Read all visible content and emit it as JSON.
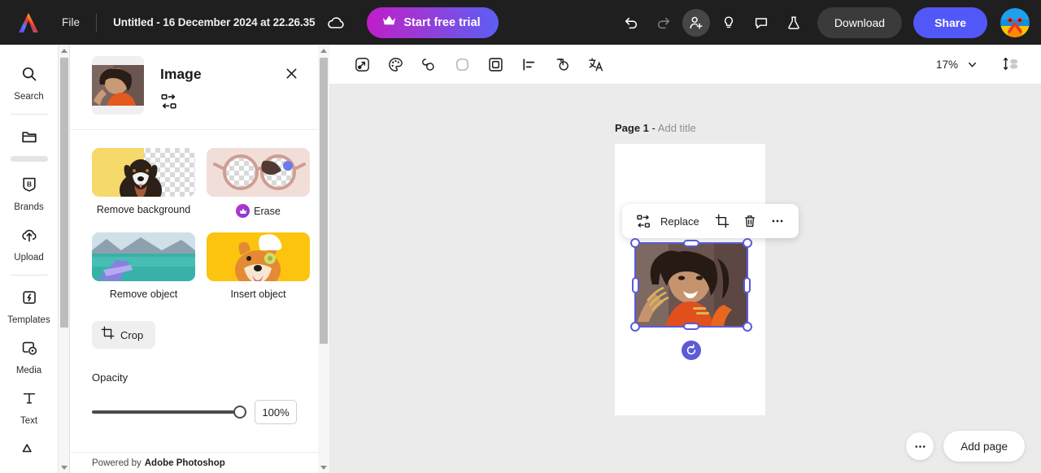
{
  "topbar": {
    "logo_icon": "adobe-express-logo",
    "file_menu": "File",
    "doc_title": "Untitled - 16 December 2024 at 22.26.35",
    "cloud_icon": "cloud-saved-icon",
    "start_trial": "Start free trial",
    "crown_icon": "crown-icon",
    "undo_icon": "undo-icon",
    "redo_icon": "redo-icon",
    "invite_icon": "add-person-icon",
    "ideas_icon": "lightbulb-icon",
    "comment_icon": "comment-icon",
    "labs_icon": "flask-icon",
    "download": "Download",
    "share": "Share",
    "avatar_icon": "user-avatar"
  },
  "rail": {
    "items": [
      {
        "label": "Search",
        "icon": "search-icon",
        "name": "sidebar-item-search"
      },
      {
        "label": "",
        "icon": "folder-icon",
        "name": "sidebar-item-yourstuff",
        "loading": true
      },
      {
        "label": "Brands",
        "icon": "brands-icon",
        "name": "sidebar-item-brands"
      },
      {
        "label": "Upload",
        "icon": "upload-cloud-icon",
        "name": "sidebar-item-upload"
      },
      {
        "label": "Templates",
        "icon": "templates-icon",
        "name": "sidebar-item-templates"
      },
      {
        "label": "Media",
        "icon": "media-icon",
        "name": "sidebar-item-media"
      },
      {
        "label": "Text",
        "icon": "text-icon",
        "name": "sidebar-item-text"
      }
    ]
  },
  "panel": {
    "title": "Image",
    "thumbnail_icon": "selected-image-thumbnail",
    "replace_icon": "replace-image-icon",
    "close_icon": "close-icon",
    "cards": [
      {
        "caption": "Remove background",
        "icon": "remove-background-preview",
        "premium": false
      },
      {
        "caption": "Erase",
        "icon": "erase-preview",
        "premium": true
      },
      {
        "caption": "Remove object",
        "icon": "remove-object-preview",
        "premium": false
      },
      {
        "caption": "Insert object",
        "icon": "insert-object-preview",
        "premium": false
      }
    ],
    "crop_label": "Crop",
    "crop_icon": "crop-icon",
    "opacity_label": "Opacity",
    "opacity_value": "100%",
    "opacity_percent": 100,
    "footer_prefix": "Powered by",
    "footer_brand": "Adobe Photoshop"
  },
  "canvas_toolbar": {
    "icons": [
      {
        "name": "effects-icon",
        "title": "Effects"
      },
      {
        "name": "color-palette-icon",
        "title": "Color"
      },
      {
        "name": "shadow-icon",
        "title": "Shadow"
      },
      {
        "name": "rounded-corners-icon",
        "title": "Corners"
      },
      {
        "name": "frame-icon",
        "title": "Frame"
      },
      {
        "name": "align-icon",
        "title": "Align"
      },
      {
        "name": "layers-icon",
        "title": "Layers"
      },
      {
        "name": "translate-icon",
        "title": "Translate"
      }
    ],
    "zoom_level": "17%",
    "zoom_caret_icon": "chevron-down-icon",
    "fit_icon": "fit-to-screen-icon"
  },
  "canvas": {
    "page_label": "Page 1",
    "page_dash": "-",
    "add_title": "Add title",
    "object_toolbar": {
      "replace_icon": "replace-image-icon",
      "replace_label": "Replace",
      "crop_icon": "crop-icon",
      "delete_icon": "trash-icon",
      "more_icon": "more-options-icon"
    },
    "selection": {
      "rotate_icon": "rotate-handle-icon",
      "image_name": "selected-photo"
    },
    "more_icon": "more-options-icon",
    "add_page": "Add page"
  },
  "colors": {
    "brand_purple": "#5258f7",
    "selection_blue": "#5b5bd6",
    "topbar_bg": "#1f1f1f",
    "canvas_bg": "#ebebeb",
    "trial_gradient_start": "#c01dc9",
    "trial_gradient_end": "#5b5ff5"
  }
}
